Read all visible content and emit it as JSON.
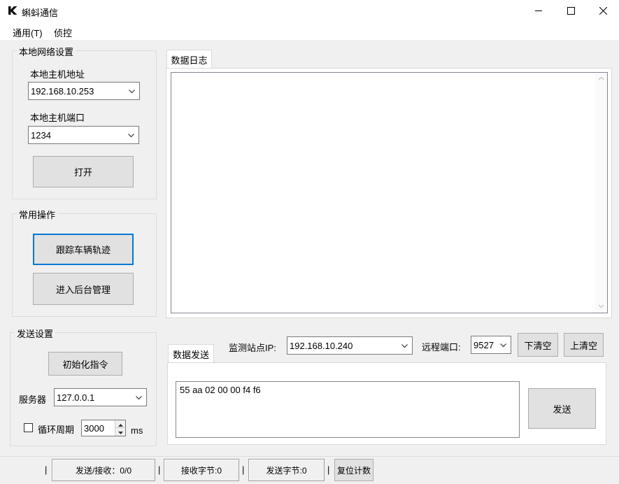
{
  "window": {
    "title": "蝌蚪通信",
    "minimize_icon": "minimize-icon",
    "maximize_icon": "maximize-icon",
    "close_icon": "close-icon"
  },
  "menu": {
    "items": [
      "通用(T)",
      "侦控"
    ]
  },
  "local_network": {
    "legend": "本地网络设置",
    "host_address_label": "本地主机地址",
    "host_address_value": "192.168.10.253",
    "host_port_label": "本地主机端口",
    "host_port_value": "1234",
    "open_button": "打开"
  },
  "common_ops": {
    "legend": "常用操作",
    "track_button": "跟踪车辆轨迹",
    "admin_button": "进入后台管理"
  },
  "send_settings": {
    "legend": "发送设置",
    "init_button": "初始化指令",
    "server_label": "服务器",
    "server_value": "127.0.0.1",
    "loop_label": "循环周期",
    "loop_checked": false,
    "loop_value": "3000",
    "loop_unit": "ms"
  },
  "data_log": {
    "tab_label": "数据日志",
    "content": ""
  },
  "data_send": {
    "tab_label": "数据发送",
    "station_ip_label": "监测站点IP:",
    "station_ip_value": "192.168.10.240",
    "remote_port_label": "远程端口:",
    "remote_port_value": "9527",
    "clear_down_button": "下清空",
    "clear_up_button": "上清空",
    "payload": "55 aa 02 00 00 f4 f6",
    "send_button": "发送"
  },
  "status_bar": {
    "send_receive": "发送/接收：0/0",
    "recv_bytes": "接收字节:0",
    "send_bytes": "发送字节:0",
    "reset_button": "复位计数",
    "separator": "|"
  },
  "colors": {
    "accent": "#0078d7",
    "window_bg": "#f0f0f0",
    "button_bg": "#e1e1e1"
  }
}
